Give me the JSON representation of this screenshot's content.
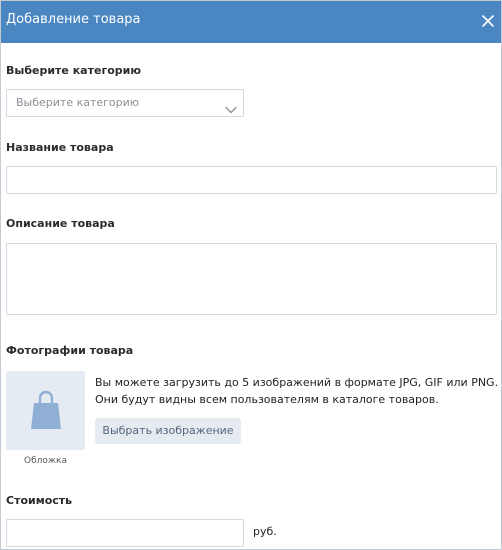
{
  "header": {
    "title": "Добавление товара",
    "close_icon": "close-icon",
    "background_color": "#4a86c1"
  },
  "category": {
    "label": "Выберите категорию",
    "selected": "Выберите категорию",
    "chevron_icon": "chevron-down-icon"
  },
  "name": {
    "label": "Название товара",
    "value": ""
  },
  "description": {
    "label": "Описание товара",
    "value": ""
  },
  "photos": {
    "label": "Фотографии товара",
    "placeholder_icon": "shopping-bag-icon",
    "cover_caption": "Обложка",
    "hint": "Вы можете загрузить до 5 изображений в формате JPG, GIF или PNG. Они будут видны всем пользователям в каталоге товаров.",
    "choose_button": "Выбрать изображение"
  },
  "price": {
    "label": "Стоимость",
    "value": "",
    "currency": "руб."
  }
}
